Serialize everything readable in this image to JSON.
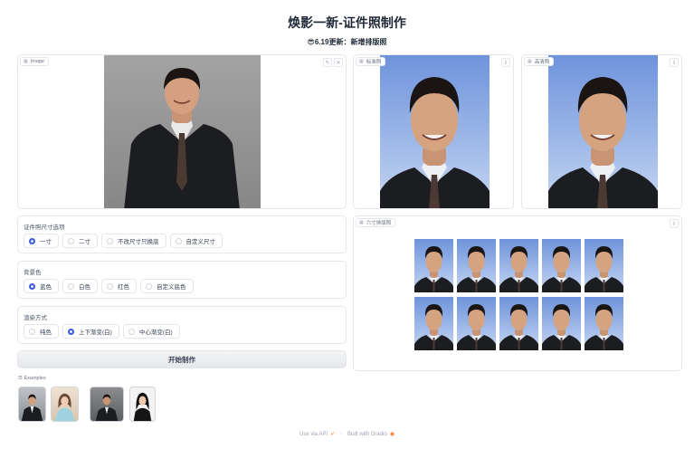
{
  "header": {
    "title": "焕影一新-证件照制作",
    "subtitle_emoji": "😎",
    "subtitle": "6.19更新：新增排版照"
  },
  "input_image": {
    "label": "Image",
    "label_icon": "image-icon",
    "edit_icon": "pencil-icon",
    "clear_icon": "close-icon"
  },
  "output_standard": {
    "label": "标准照",
    "label_icon": "image-icon",
    "download_icon": "download-icon"
  },
  "output_hd": {
    "label": "高清照",
    "label_icon": "image-icon",
    "download_icon": "download-icon"
  },
  "output_layout": {
    "label": "六寸排版照",
    "label_icon": "image-icon",
    "download_icon": "download-icon",
    "grid_rows": 2,
    "grid_cols": 5
  },
  "size_options": {
    "title": "证件照尺寸选项",
    "options": [
      "一寸",
      "二寸",
      "不改尺寸只换底",
      "自定义尺寸"
    ],
    "selected": 0
  },
  "bg_color": {
    "title": "背景色",
    "options": [
      "蓝色",
      "白色",
      "红色",
      "自定义底色"
    ],
    "selected": 0
  },
  "render_mode": {
    "title": "渲染方式",
    "options": [
      "纯色",
      "上下渐变(白)",
      "中心渐变(白)"
    ],
    "selected": 1
  },
  "actions": {
    "start": "开始制作"
  },
  "examples": {
    "label": "Examples",
    "label_icon": "list-icon"
  },
  "footer": {
    "api": "Use via API",
    "api_icon": "rocket-icon",
    "separator": "·",
    "built": "Built with Gradio",
    "built_icon": "gradio-logo-icon"
  },
  "colors": {
    "accent": "#3b5bdb",
    "id_blue": "#6f93dc",
    "border": "#e5e7eb"
  }
}
